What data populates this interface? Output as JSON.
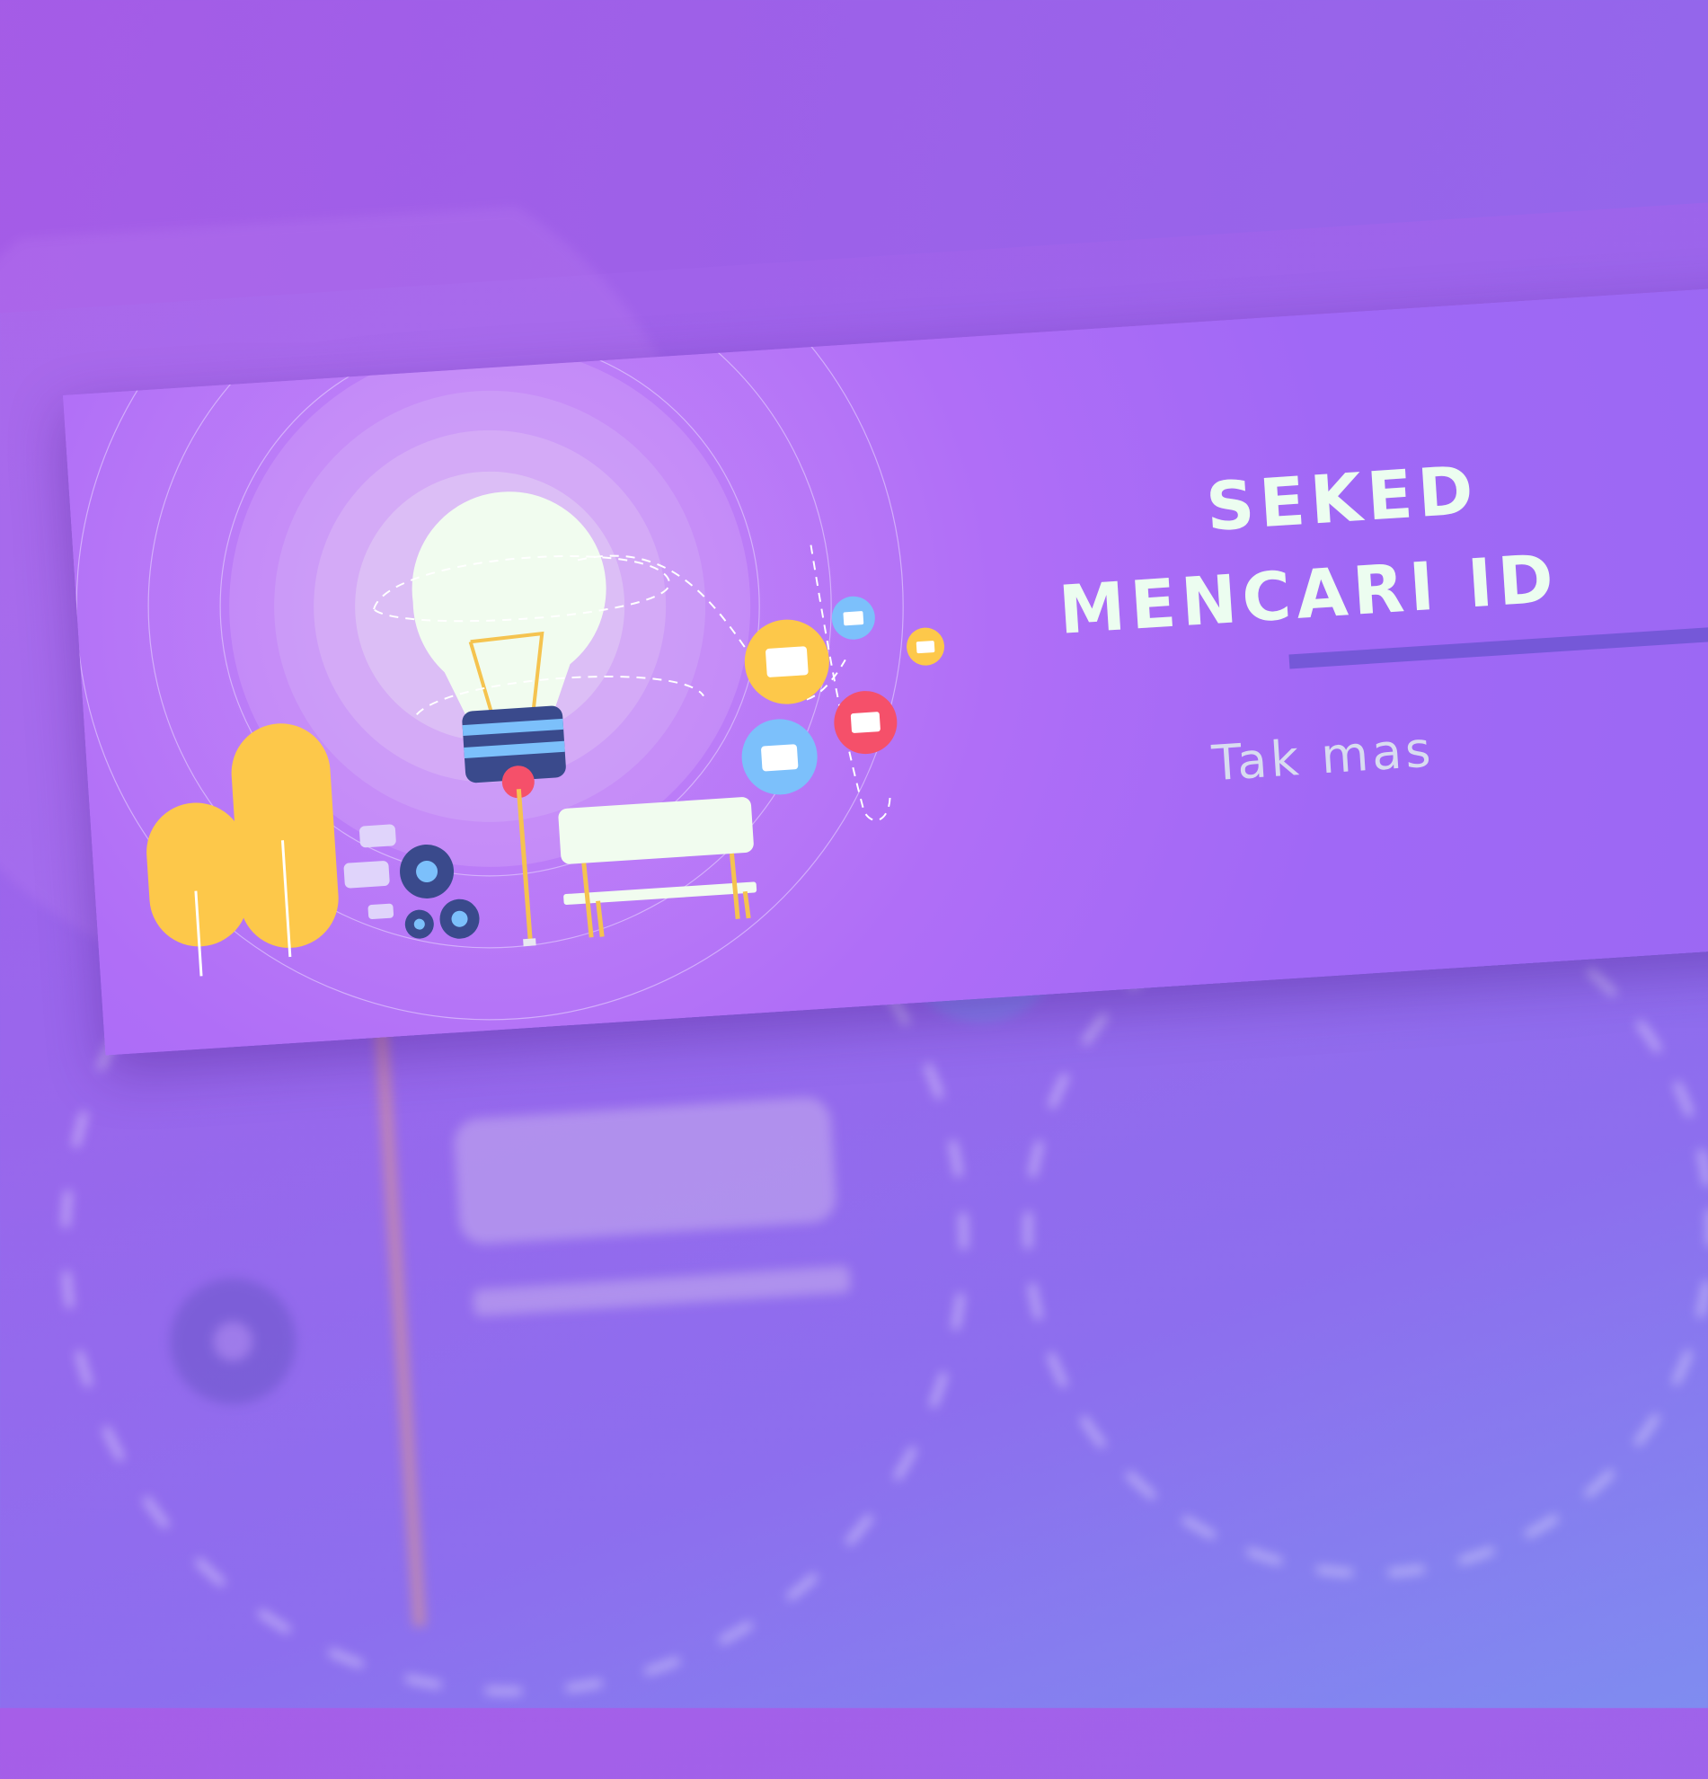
{
  "slide": {
    "title_line1": "SEKED",
    "title_line2": "MENCARI ID",
    "subtitle": "Tak mas"
  },
  "colors": {
    "purple": "#a068f6",
    "yellow": "#fdc84a",
    "blue": "#7cc0fb",
    "red": "#f5506a",
    "navy": "#3a4a8c",
    "cream": "#f1fcef"
  }
}
